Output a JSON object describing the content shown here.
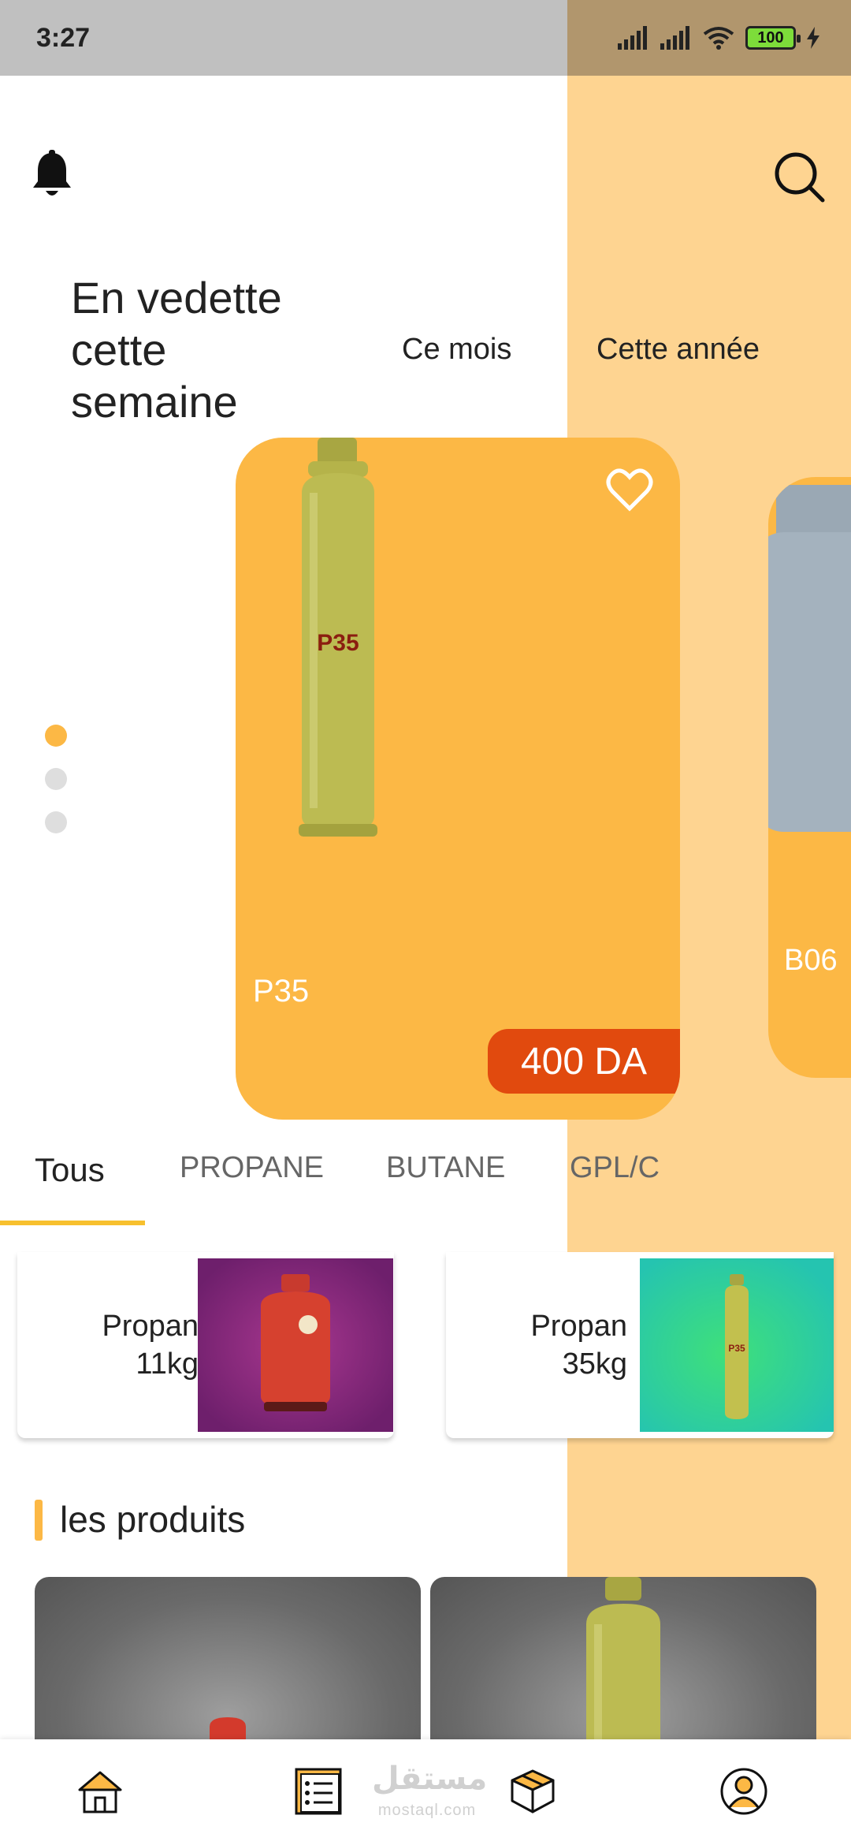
{
  "status_bar": {
    "time": "3:27",
    "battery": "100"
  },
  "header": {
    "featured_title": "En vedette cette semaine",
    "tab_month": "Ce mois",
    "tab_year": "Cette année"
  },
  "carousel": {
    "cards": [
      {
        "name": "P35",
        "price": "400 DA"
      },
      {
        "name": "B06"
      }
    ],
    "pages": 3,
    "active_page": 0
  },
  "categories": {
    "tabs": [
      "Tous",
      "PROPANE",
      "BUTANE",
      "GPL/C"
    ],
    "active": "Tous"
  },
  "featured_small": [
    {
      "line1": "Propan",
      "line2": "11kg"
    },
    {
      "line1": "Propan",
      "line2": "35kg"
    }
  ],
  "products_section": {
    "title": "les produits"
  },
  "watermark": {
    "arabic": "مستقل",
    "latin": "mostaql.com"
  },
  "bottom_nav": {
    "items": [
      "home-icon",
      "list-icon",
      "box-icon",
      "profile-icon"
    ],
    "active": "home-icon"
  },
  "colors": {
    "accent": "#fcb845",
    "panel": "#fed491",
    "price": "#e14a0e",
    "underline": "#f7c02e"
  }
}
